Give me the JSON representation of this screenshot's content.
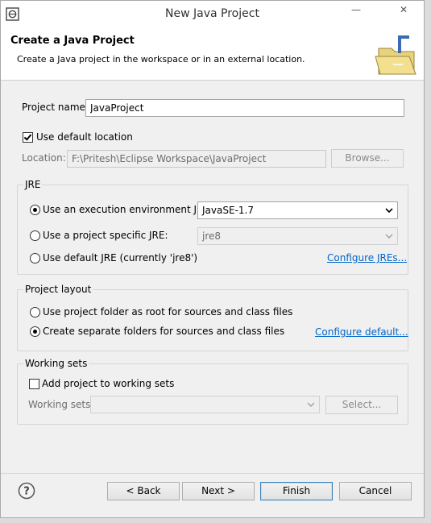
{
  "window": {
    "title": "New Java Project",
    "minimize": "—",
    "close": "✕"
  },
  "banner": {
    "title": "Create a Java Project",
    "description": "Create a Java project in the workspace or in an external location."
  },
  "project_name": {
    "label": "Project name:",
    "value": "JavaProject"
  },
  "default_location": {
    "label": "Use default location",
    "checked": true
  },
  "location": {
    "label": "Location:",
    "value": "F:\\Pritesh\\Eclipse Workspace\\JavaProject",
    "browse": "Browse..."
  },
  "jre": {
    "title": "JRE",
    "option_env": "Use an execution environment JRE:",
    "env_value": "JavaSE-1.7",
    "option_specific": "Use a project specific JRE:",
    "specific_value": "jre8",
    "option_default": "Use default JRE (currently 'jre8')",
    "configure_link": "Configure JREs..."
  },
  "layout": {
    "title": "Project layout",
    "option_root": "Use project folder as root for sources and class files",
    "option_separate": "Create separate folders for sources and class files",
    "configure_link": "Configure default..."
  },
  "working_sets": {
    "title": "Working sets",
    "add_label": "Add project to working sets",
    "sets_label": "Working sets:",
    "select_button": "Select..."
  },
  "footer": {
    "back": "< Back",
    "next": "Next >",
    "finish": "Finish",
    "cancel": "Cancel",
    "help": "?"
  },
  "icons": [
    "eclipse-app-icon",
    "minimize-icon",
    "close-icon",
    "folder-wizard-icon",
    "help-icon",
    "chevron-down-icon"
  ]
}
